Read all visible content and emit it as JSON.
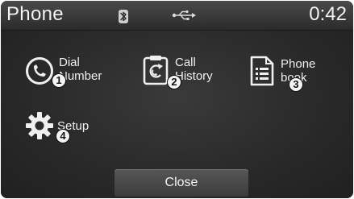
{
  "statusbar": {
    "title": "Phone",
    "time": "0:42",
    "bluetooth_icon": "bluetooth-icon",
    "usb_icon": "usb-icon"
  },
  "menu": {
    "items": [
      {
        "line1": "Dial",
        "line2": "Number",
        "badge": "1",
        "icon": "handset-icon"
      },
      {
        "line1": "Call",
        "line2": "History",
        "badge": "2",
        "icon": "call-history-icon"
      },
      {
        "line1": "Phone",
        "line2": "book",
        "badge": "3",
        "icon": "phonebook-icon"
      },
      {
        "line1": "Setup",
        "badge": "4",
        "icon": "gear-icon"
      }
    ]
  },
  "footer": {
    "close_label": "Close"
  },
  "colors": {
    "background": "#2c2c2c",
    "statusbar": "#3a3a3a",
    "text": "#f0f0f0",
    "badge": "#f4f4f4"
  }
}
